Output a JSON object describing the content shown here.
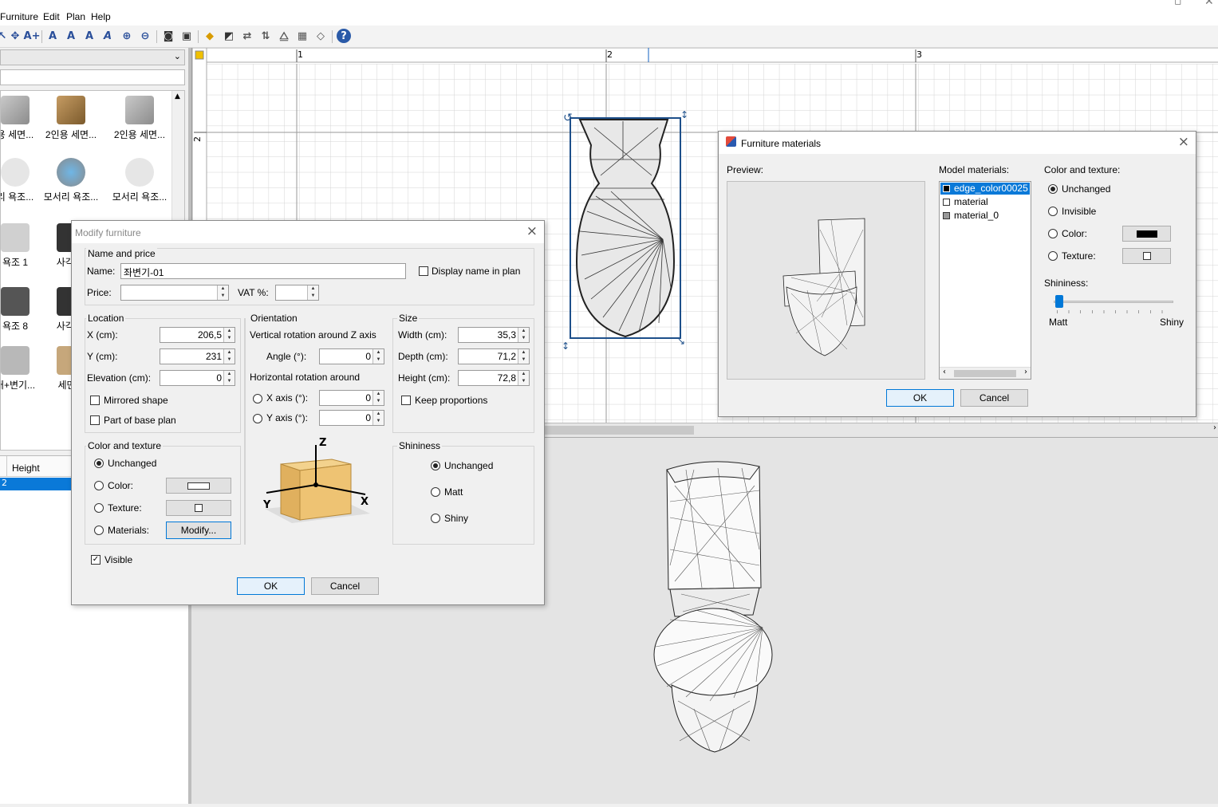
{
  "menubar": {
    "items": [
      "Furniture",
      "Edit",
      "Plan",
      "Help"
    ]
  },
  "catalog": {
    "items": [
      {
        "label": "용 세면..."
      },
      {
        "label": "2인용 세면..."
      },
      {
        "label": "2인용 세면..."
      },
      {
        "label": "리 욕조..."
      },
      {
        "label": "모서리 욕조..."
      },
      {
        "label": "모서리 욕조..."
      },
      {
        "label": "욕조 1"
      },
      {
        "label": "사각 욕"
      },
      {
        "label": "욕조 8"
      },
      {
        "label": "사각 욕"
      },
      {
        "label": "대+변기..."
      },
      {
        "label": "세면대"
      }
    ]
  },
  "furniture_table": {
    "column": "Height",
    "selected_value": "2"
  },
  "plan": {
    "ruler": [
      "1",
      "2",
      "3"
    ],
    "ruler_v": "2"
  },
  "modify": {
    "title": "Modify furniture",
    "name_price": {
      "group": "Name and price",
      "name_label": "Name:",
      "name_value": "좌변기-01",
      "display_name": "Display name in plan",
      "price_label": "Price:",
      "price_value": "",
      "vat_label": "VAT %:",
      "vat_value": ""
    },
    "location": {
      "group": "Location",
      "x_label": "X (cm):",
      "x_value": "206,5",
      "y_label": "Y (cm):",
      "y_value": "231",
      "elev_label": "Elevation (cm):",
      "elev_value": "0",
      "mirrored": "Mirrored shape",
      "base_plan": "Part of base plan"
    },
    "orientation": {
      "group": "Orientation",
      "vertical_label": "Vertical rotation around Z axis",
      "angle_label": "Angle (°):",
      "angle_value": "0",
      "horizontal_label": "Horizontal rotation around",
      "xaxis_label": "X axis (°):",
      "xaxis_value": "0",
      "yaxis_label": "Y axis (°):",
      "yaxis_value": "0",
      "diagram_z": "Z",
      "diagram_x": "X",
      "diagram_y": "Y"
    },
    "size": {
      "group": "Size",
      "width_label": "Width (cm):",
      "width_value": "35,3",
      "depth_label": "Depth (cm):",
      "depth_value": "71,2",
      "height_label": "Height (cm):",
      "height_value": "72,8",
      "keep_proportions": "Keep proportions"
    },
    "color_texture": {
      "group": "Color and texture",
      "unchanged": "Unchanged",
      "color": "Color:",
      "texture": "Texture:",
      "materials": "Materials:",
      "modify_button": "Modify..."
    },
    "shininess": {
      "group": "Shininess",
      "unchanged": "Unchanged",
      "matt": "Matt",
      "shiny": "Shiny"
    },
    "visible": "Visible",
    "ok": "OK",
    "cancel": "Cancel"
  },
  "materials": {
    "title": "Furniture materials",
    "preview_label": "Preview:",
    "model_materials_label": "Model materials:",
    "items": [
      "edge_color00025",
      "material",
      "material_0"
    ],
    "color_texture_label": "Color and texture:",
    "unchanged": "Unchanged",
    "invisible": "Invisible",
    "color": "Color:",
    "texture": "Texture:",
    "shininess_label": "Shininess:",
    "matt": "Matt",
    "shiny": "Shiny",
    "shininess_level": 0,
    "ok": "OK",
    "cancel": "Cancel"
  },
  "colors": {
    "selection": "#0a79d8",
    "accent": "#0078d7"
  }
}
